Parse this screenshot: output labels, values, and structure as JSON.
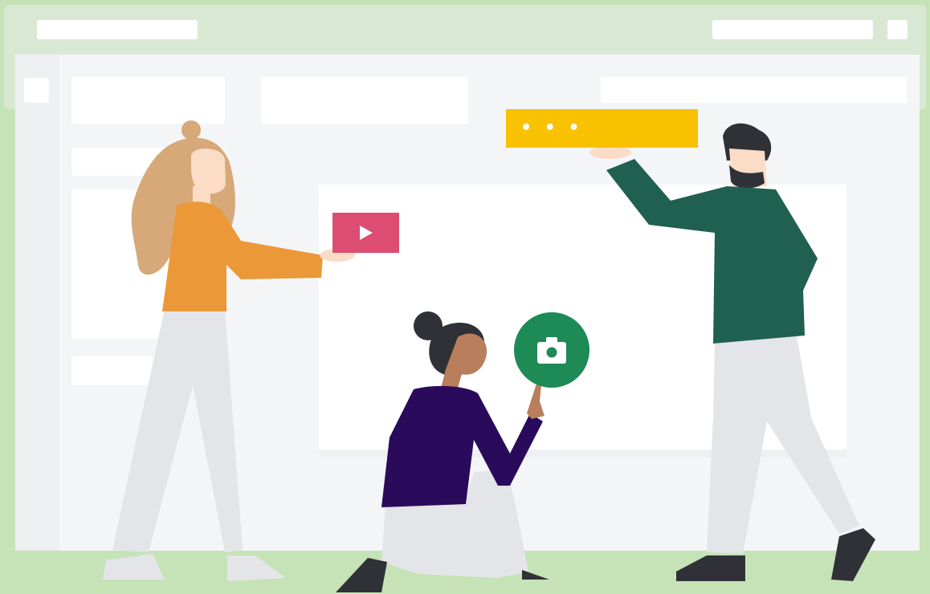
{
  "illustration": {
    "colors": {
      "page_background": "#c6e3b8",
      "window_header": "#d9e8d3",
      "window_body": "#f4f5f7",
      "window_panel": "#ffffff",
      "video_card": "#dd4c72",
      "camera_badge": "#1e8a55",
      "menu_bar": "#f8c200",
      "woman_left_top": "#eb9838",
      "woman_left_hair": "#d7a878",
      "woman_center_top": "#2a0a5a",
      "man_right_top": "#1f6050",
      "pants": "#e3e5e8",
      "shoes": "#2f3137",
      "skin_light": "#fbdcc6",
      "skin_dark": "#b97e5b"
    },
    "icons": {
      "video": "play-icon",
      "camera": "camera-icon",
      "menu": "more-dots-icon"
    },
    "menu_bar_glyph": "• • •"
  }
}
